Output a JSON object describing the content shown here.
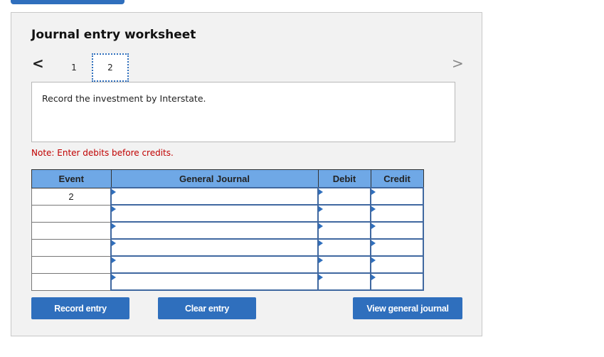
{
  "worksheet": {
    "title": "Journal entry worksheet",
    "nav": {
      "prev_icon": "chevron-left-icon",
      "next_icon": "chevron-right-icon",
      "prev_glyph": "<",
      "next_glyph": ">"
    },
    "tabs": [
      {
        "label": "1",
        "active": false
      },
      {
        "label": "2",
        "active": true
      }
    ],
    "description": "Record the investment by Interstate.",
    "note": "Note: Enter debits before credits.",
    "table": {
      "headers": [
        "Event",
        "General Journal",
        "Debit",
        "Credit"
      ],
      "rows": [
        {
          "event": "2",
          "account": "",
          "debit": "",
          "credit": ""
        },
        {
          "event": "",
          "account": "",
          "debit": "",
          "credit": ""
        },
        {
          "event": "",
          "account": "",
          "debit": "",
          "credit": ""
        },
        {
          "event": "",
          "account": "",
          "debit": "",
          "credit": ""
        },
        {
          "event": "",
          "account": "",
          "debit": "",
          "credit": ""
        },
        {
          "event": "",
          "account": "",
          "debit": "",
          "credit": ""
        }
      ]
    },
    "buttons": {
      "record": "Record entry",
      "clear": "Clear entry",
      "view": "View general journal"
    }
  },
  "colors": {
    "accent": "#2f6fbd",
    "header_bg": "#6fa8e6",
    "note": "#c00000",
    "panel_bg": "#f2f2f2"
  }
}
